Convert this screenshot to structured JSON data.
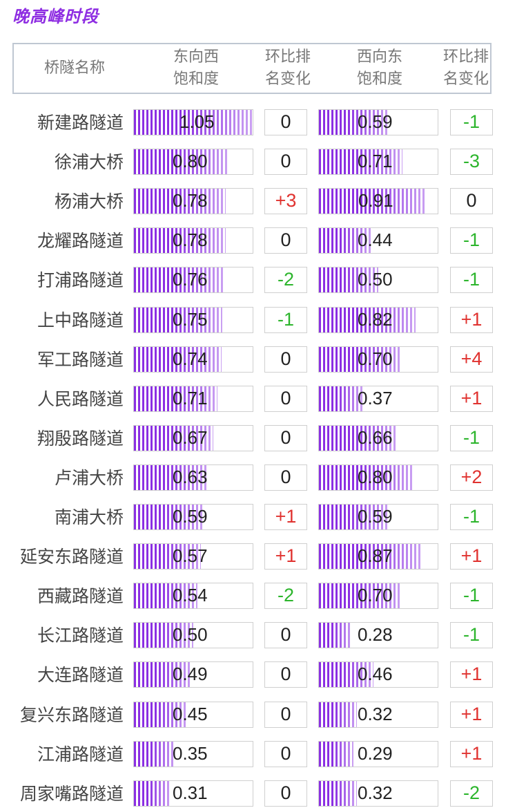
{
  "title": "晚高峰时段",
  "headers": {
    "name": "桥隧名称",
    "ew_saturation": "东向西\n饱和度",
    "ew_rank_change": "环比排\n名变化",
    "we_saturation": "西向东\n饱和度",
    "we_rank_change": "环比排\n名变化"
  },
  "colors": {
    "bar": "#8b2fe3",
    "increase": "#e0322f",
    "decrease": "#2cb52c",
    "title": "#8e2de2"
  },
  "chart_data": {
    "type": "table",
    "columns": [
      "桥隧名称",
      "东向西饱和度",
      "环比排名变化",
      "西向东饱和度",
      "环比排名变化"
    ],
    "rows": [
      {
        "name": "新建路隧道",
        "ew": "1.05",
        "ew_chg": "0",
        "we": "0.59",
        "we_chg": "-1"
      },
      {
        "name": "徐浦大桥",
        "ew": "0.80",
        "ew_chg": "0",
        "we": "0.71",
        "we_chg": "-3"
      },
      {
        "name": "杨浦大桥",
        "ew": "0.78",
        "ew_chg": "+3",
        "we": "0.91",
        "we_chg": "0"
      },
      {
        "name": "龙耀路隧道",
        "ew": "0.78",
        "ew_chg": "0",
        "we": "0.44",
        "we_chg": "-1"
      },
      {
        "name": "打浦路隧道",
        "ew": "0.76",
        "ew_chg": "-2",
        "we": "0.50",
        "we_chg": "-1"
      },
      {
        "name": "上中路隧道",
        "ew": "0.75",
        "ew_chg": "-1",
        "we": "0.82",
        "we_chg": "+1"
      },
      {
        "name": "军工路隧道",
        "ew": "0.74",
        "ew_chg": "0",
        "we": "0.70",
        "we_chg": "+4"
      },
      {
        "name": "人民路隧道",
        "ew": "0.71",
        "ew_chg": "0",
        "we": "0.37",
        "we_chg": "+1"
      },
      {
        "name": "翔殷路隧道",
        "ew": "0.67",
        "ew_chg": "0",
        "we": "0.66",
        "we_chg": "-1"
      },
      {
        "name": "卢浦大桥",
        "ew": "0.63",
        "ew_chg": "0",
        "we": "0.80",
        "we_chg": "+2"
      },
      {
        "name": "南浦大桥",
        "ew": "0.59",
        "ew_chg": "+1",
        "we": "0.59",
        "we_chg": "-1"
      },
      {
        "name": "延安东路隧道",
        "ew": "0.57",
        "ew_chg": "+1",
        "we": "0.87",
        "we_chg": "+1"
      },
      {
        "name": "西藏路隧道",
        "ew": "0.54",
        "ew_chg": "-2",
        "we": "0.70",
        "we_chg": "-1"
      },
      {
        "name": "长江路隧道",
        "ew": "0.50",
        "ew_chg": "0",
        "we": "0.28",
        "we_chg": "-1"
      },
      {
        "name": "大连路隧道",
        "ew": "0.49",
        "ew_chg": "0",
        "we": "0.46",
        "we_chg": "+1"
      },
      {
        "name": "复兴东路隧道",
        "ew": "0.45",
        "ew_chg": "0",
        "we": "0.32",
        "we_chg": "+1"
      },
      {
        "name": "江浦路隧道",
        "ew": "0.35",
        "ew_chg": "0",
        "we": "0.29",
        "we_chg": "+1"
      },
      {
        "name": "周家嘴路隧道",
        "ew": "0.31",
        "ew_chg": "0",
        "we": "0.32",
        "we_chg": "-2"
      }
    ]
  }
}
